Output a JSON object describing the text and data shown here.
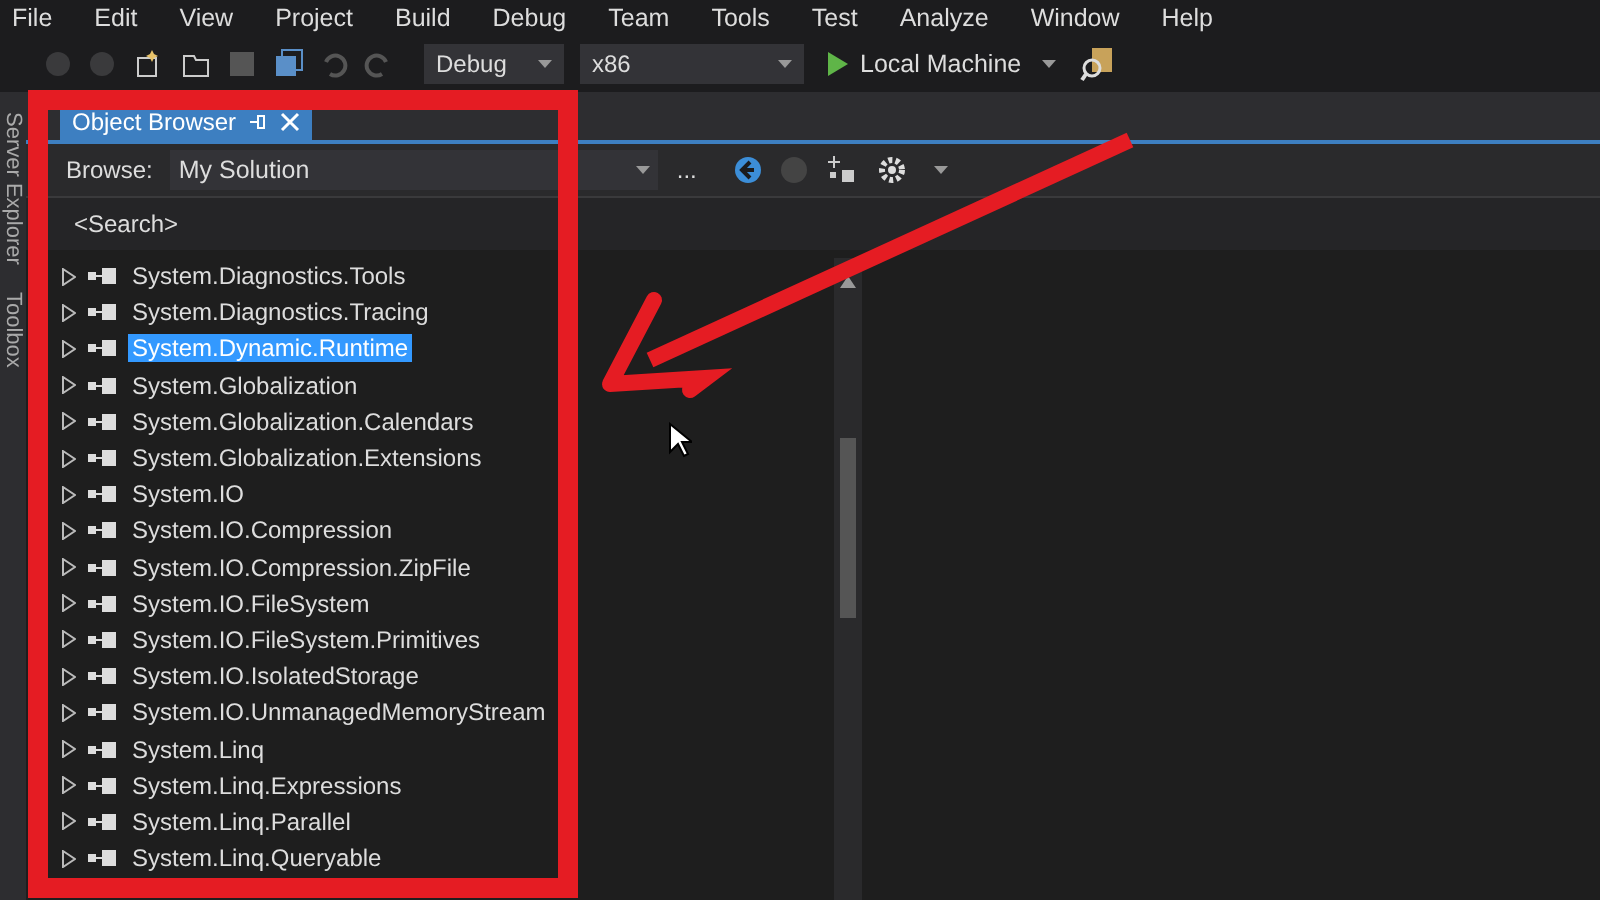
{
  "menu": [
    "File",
    "Edit",
    "View",
    "Project",
    "Build",
    "Debug",
    "Team",
    "Tools",
    "Test",
    "Analyze",
    "Window",
    "Help"
  ],
  "toolbar": {
    "configuration": "Debug",
    "platform": "x86",
    "run_target": "Local Machine"
  },
  "side_tabs": [
    "Server Explorer",
    "Toolbox"
  ],
  "object_browser": {
    "title": "Object Browser",
    "browse_label": "Browse:",
    "browse_value": "My Solution",
    "more": "...",
    "search": {
      "placeholder": "<Search>"
    },
    "items": [
      {
        "name": "System.Diagnostics.Tools",
        "selected": false
      },
      {
        "name": "System.Diagnostics.Tracing",
        "selected": false
      },
      {
        "name": "System.Dynamic.Runtime",
        "selected": true
      },
      {
        "name": "System.Globalization",
        "selected": false
      },
      {
        "name": "System.Globalization.Calendars",
        "selected": false
      },
      {
        "name": "System.Globalization.Extensions",
        "selected": false
      },
      {
        "name": "System.IO",
        "selected": false
      },
      {
        "name": "System.IO.Compression",
        "selected": false
      },
      {
        "name": "System.IO.Compression.ZipFile",
        "selected": false
      },
      {
        "name": "System.IO.FileSystem",
        "selected": false
      },
      {
        "name": "System.IO.FileSystem.Primitives",
        "selected": false
      },
      {
        "name": "System.IO.IsolatedStorage",
        "selected": false
      },
      {
        "name": "System.IO.UnmanagedMemoryStream",
        "selected": false
      },
      {
        "name": "System.Linq",
        "selected": false
      },
      {
        "name": "System.Linq.Expressions",
        "selected": false
      },
      {
        "name": "System.Linq.Parallel",
        "selected": false
      },
      {
        "name": "System.Linq.Queryable",
        "selected": false
      }
    ]
  }
}
